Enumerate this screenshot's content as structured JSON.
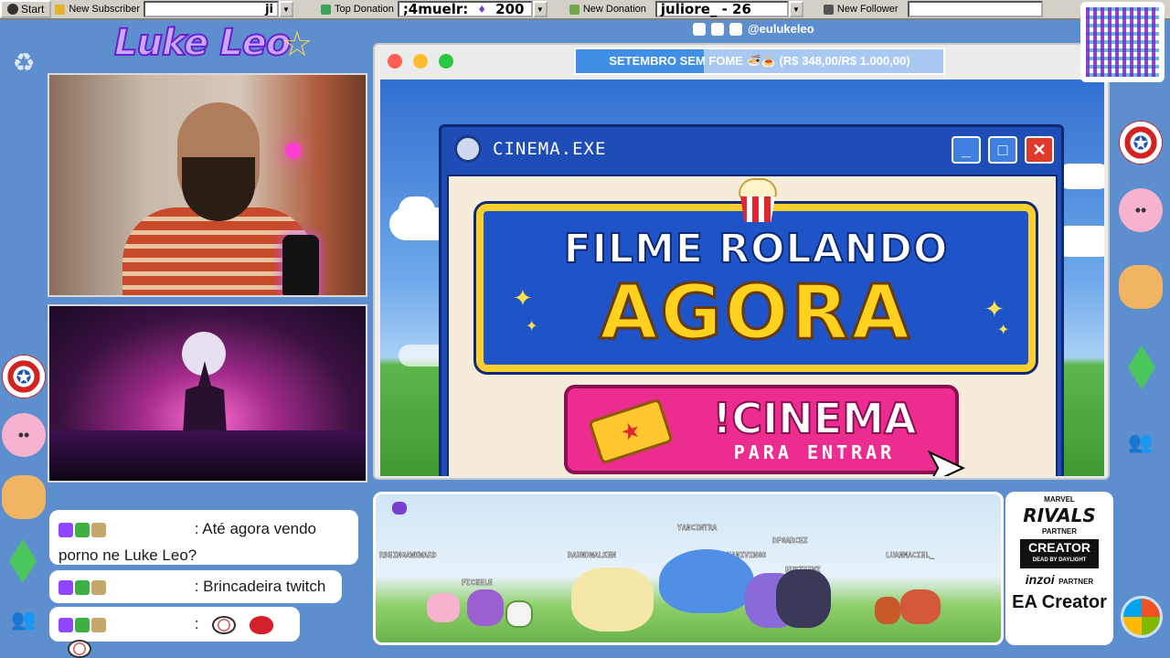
{
  "taskbar": {
    "start_label": "Start",
    "new_subscriber_label": "New Subscriber",
    "subscriber_value": "ji",
    "top_donation_label": "Top Donation",
    "top_donation_name": ";4muelr:",
    "top_donation_amount": "200",
    "new_donation_label": "New Donation",
    "new_donation_value": "juliore_ - 26",
    "new_follower_label": "New Follower",
    "new_follower_value": ""
  },
  "logo": {
    "text": "Luke Leo"
  },
  "social": {
    "handle": "@eulukeleo"
  },
  "donation_goal": {
    "text": "SETEMBRO SEM FOME 🍜🍝 (R$ 348,00/R$ 1.000,00)",
    "current": 348,
    "target": 1000
  },
  "cinema_window": {
    "title": "CINEMA.EXE",
    "headline_line1": "FILME ROLANDO",
    "headline_line2": "AGORA",
    "command": "!CINEMA",
    "command_sub": "PARA ENTRAR"
  },
  "chat": {
    "messages": [
      {
        "text": ": Até agora vendo porno ne Luke Leo?"
      },
      {
        "text": ": Brincadeira twitch"
      },
      {
        "text": ":"
      }
    ]
  },
  "pets": {
    "names": [
      "RBEINGAWKWARD",
      "FICHELE",
      "BAUNDWALKEN",
      "YANCINTRA",
      "KANIVINGO",
      "DFGARCEZ",
      "EUSTEINZ",
      "LUANMACIEL_"
    ]
  },
  "partners": {
    "rivals_brand": "MARVEL",
    "rivals": "RIVALS",
    "rivals_tag": "PARTNER",
    "creator": "CREATOR",
    "creator_sub": "DEAD BY DAYLIGHT",
    "inzoi": "inzoi",
    "inzoi_tag": "PARTNER",
    "ea": "EA Creator"
  },
  "colors": {
    "desktop": "#5d8fce",
    "accent_pink": "#ec2d8f",
    "accent_yellow": "#ffd21f",
    "cinema_blue": "#1f4db8"
  },
  "icons": [
    "recycle-bin-icon",
    "captain-shield-icon",
    "jigglypuff-icon",
    "blonde-face-icon",
    "plumbob-gem-icon",
    "msn-people-icon",
    "windows-orb-icon"
  ]
}
